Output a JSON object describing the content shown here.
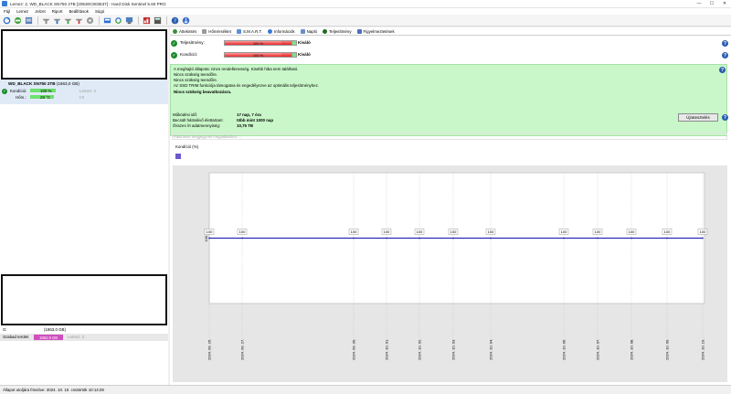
{
  "titlebar": {
    "title": "Lemez: 2, WD_BLACK SN750 2TB [20530C803537] - Hard Disk Sentinel 5.60 PRO",
    "minimize": "—",
    "maximize": "☐",
    "close": "✕"
  },
  "menu": [
    "Fájl",
    "Lemez",
    "Jelzet",
    "Riport",
    "Beállítások",
    "Súgó"
  ],
  "tabs": [
    {
      "label": "Áttekintés",
      "color": "#3a8f3a"
    },
    {
      "label": "Hőmérséklet",
      "color": "#999999"
    },
    {
      "label": "S.M.A.R.T.",
      "color": "#5b8fd6"
    },
    {
      "label": "Információk",
      "color": "#3a7bd5"
    },
    {
      "label": "Napló",
      "color": "#6a8fc8"
    },
    {
      "label": "Teljesítmény",
      "color": "#1f6b1f"
    },
    {
      "label": "Figyelmeztetések",
      "color": "#4c6fbf"
    }
  ],
  "status": {
    "performance": {
      "label": "Teljesítmény:",
      "percent_text": "100 %",
      "value": "Kiváló",
      "level": 0.85
    },
    "health": {
      "label": "Kondíció:",
      "percent_text": "100 %",
      "value": "Kiváló",
      "level": 0.85
    }
  },
  "message": {
    "lines": [
      "A meghajtó állapota: nincs rendellenesség. Kisebb hiba nem található.",
      "Nincs szükség teendőre.",
      "Nincs szükség teendőre.",
      "Az SSD TRIM funkciója támogatva és engedélyezve az optimális teljesítményhez."
    ],
    "conclusion": "Nincs szükség beavatkozásra."
  },
  "info": {
    "uptime": {
      "label": "Működési idő:",
      "value": "17 nap, 7 óra"
    },
    "lifetime": {
      "label": "Becsült hátralévő élettartam:",
      "value": "több mint 1000 nap"
    },
    "written": {
      "label": "Összes írt adatmennyiség:",
      "value": "10,75 TB"
    },
    "refresh_button": "Újratesztelés",
    "comment_placeholder": "Kattintson megjegyzés megadásához ..."
  },
  "drive": {
    "name": "WD_BLACK SN750 2TB",
    "size": "(1863,0 GB)",
    "condition_label": "Kondíció:",
    "condition_value": "100 %",
    "condition_disk": "Lemez: 2",
    "temp_label": "Hőm.:",
    "temp_value": "28 °C",
    "temp_disk": "I:0"
  },
  "partition": {
    "drive_letter": "G:",
    "size": "(1863,0 GB)",
    "free_label": "Szabad terület",
    "free_value": "1862,9 GB",
    "disk": "Lemez: 2"
  },
  "chart_data": {
    "type": "line",
    "title": "Kondíció  (%)",
    "categories": [
      "2024. 09. 26.",
      "2024. 09. 27.",
      "2024. 09. 30.",
      "2024. 10. 01.",
      "2024. 10. 02.",
      "2024. 10. 03.",
      "2024. 10. 04.",
      "2024. 10. 06.",
      "2024. 10. 07.",
      "2024. 10. 08.",
      "2024. 10. 09.",
      "2024. 10. 10."
    ],
    "values": [
      100,
      100,
      100,
      100,
      100,
      100,
      100,
      100,
      100,
      100,
      100,
      100
    ],
    "ylabel": "100",
    "line_color": "#2929b8",
    "grid": true
  },
  "statusbar": {
    "text": "Állapot utoljára frissítve: 2024. 10. 10. csütörtök 10:14:29"
  }
}
